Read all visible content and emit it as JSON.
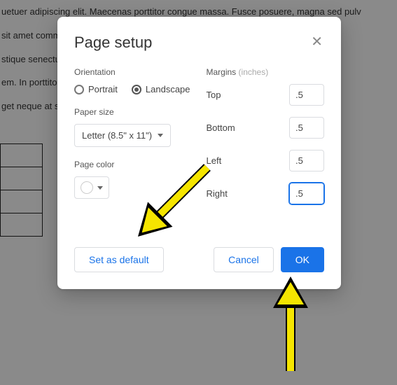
{
  "background": {
    "line1": "uetuer adipiscing elit. Maecenas porttitor congue massa. Fusce posuere, magna sed pulv",
    "line2": " sit amet commodo magna eros quis urna.                                                                                   usce est. Vivam",
    "line3": "stique senectus et netus et malesuada fames ac turpis egestas.                                               etra nonummy",
    "line4": "em. In porttitor. Donec laoreet nonummy augue.                                                                    elerisque at, v",
    "line5": "get neque at sem venenatis eleifend."
  },
  "dialog": {
    "title": "Page setup",
    "orientation": {
      "label": "Orientation",
      "portrait": "Portrait",
      "landscape": "Landscape",
      "selected": "landscape"
    },
    "paper_size": {
      "label": "Paper size",
      "value": "Letter (8.5\" x 11\")"
    },
    "page_color": {
      "label": "Page color"
    },
    "margins": {
      "label": "Margins",
      "unit": "(inches)",
      "top": {
        "label": "Top",
        "value": ".5"
      },
      "bottom": {
        "label": "Bottom",
        "value": ".5"
      },
      "left": {
        "label": "Left",
        "value": ".5"
      },
      "right": {
        "label": "Right",
        "value": ".5"
      }
    },
    "buttons": {
      "set_default": "Set as default",
      "cancel": "Cancel",
      "ok": "OK"
    }
  }
}
